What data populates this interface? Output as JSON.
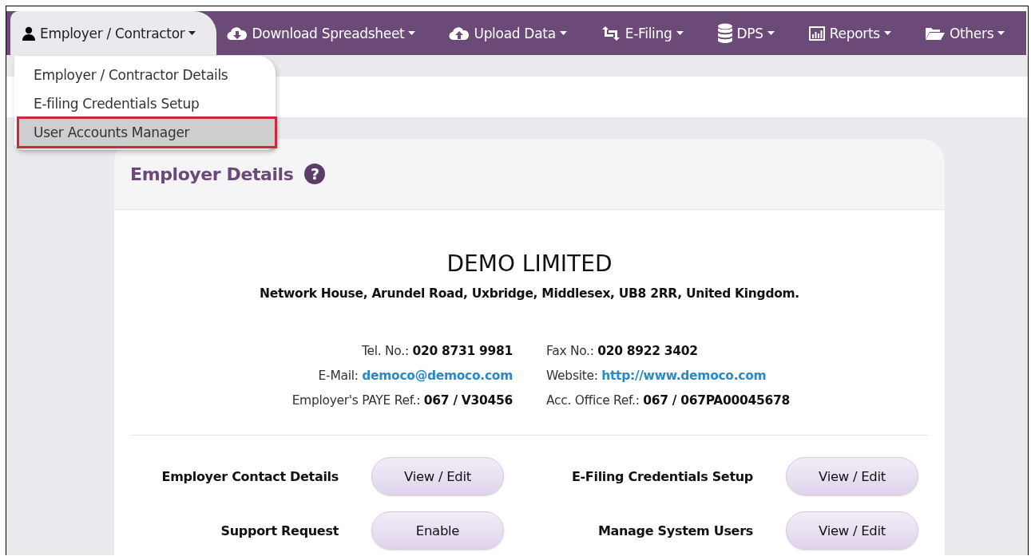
{
  "nav": {
    "items": [
      {
        "label": "Employer / Contractor",
        "selected": true
      },
      {
        "label": "Download Spreadsheet",
        "selected": false
      },
      {
        "label": "Upload Data",
        "selected": false
      },
      {
        "label": "E-Filing",
        "selected": false
      },
      {
        "label": "DPS",
        "selected": false
      },
      {
        "label": "Reports",
        "selected": false
      },
      {
        "label": "Others",
        "selected": false
      }
    ]
  },
  "dropdown": {
    "items": [
      {
        "label": "Employer / Contractor Details",
        "selected": false
      },
      {
        "label": "E-filing Credentials Setup",
        "selected": false
      },
      {
        "label": "User Accounts Manager",
        "selected": true
      }
    ]
  },
  "card": {
    "title": "Employer Details",
    "help": "?",
    "company": "DEMO LIMITED",
    "address": "Network House, Arundel Road, Uxbridge, Middlesex, UB8 2RR, United Kingdom.",
    "contacts": [
      {
        "label": "Tel. No.:",
        "value": "020 8731 9981",
        "kind": "text"
      },
      {
        "label": "Fax No.:",
        "value": "020 8922 3402",
        "kind": "text"
      },
      {
        "label": "E-Mail:",
        "value": "democo@democo.com",
        "kind": "link"
      },
      {
        "label": "Website:",
        "value": "http://www.democo.com",
        "kind": "link"
      },
      {
        "label": "Employer's PAYE Ref.:",
        "value": "067 / V30456",
        "kind": "text"
      },
      {
        "label": "Acc. Office Ref.:",
        "value": "067 / 067PA00045678",
        "kind": "text"
      }
    ],
    "actions": [
      {
        "label": "Employer Contact Details",
        "button": "View / Edit"
      },
      {
        "label": "E-Filing Credentials Setup",
        "button": "View / Edit"
      },
      {
        "label": "Support Request",
        "button": "Enable"
      },
      {
        "label": "Manage System Users",
        "button": "View / Edit"
      }
    ]
  }
}
